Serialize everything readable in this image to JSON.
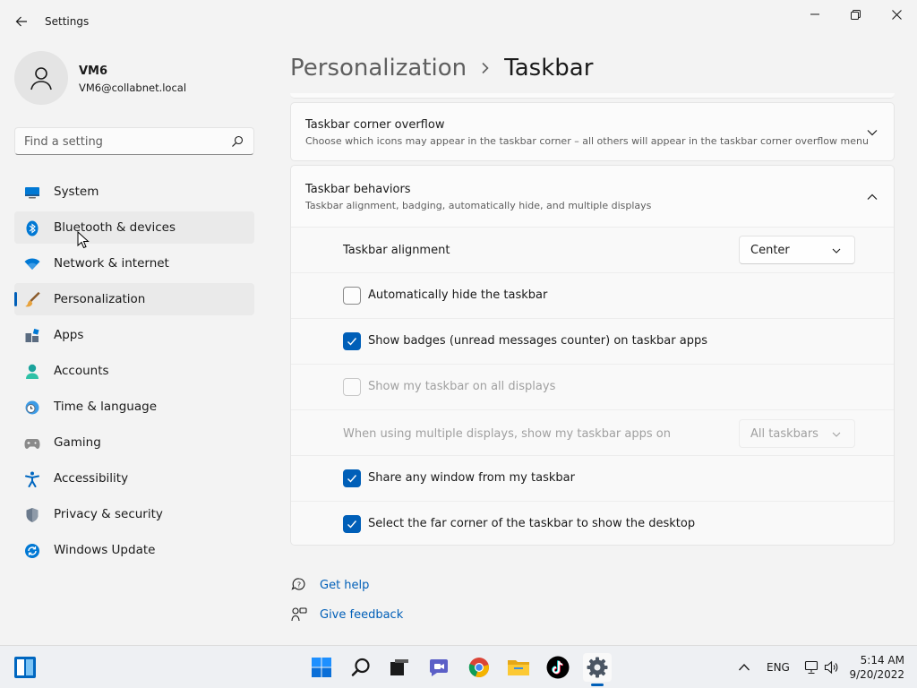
{
  "window": {
    "title": "Settings"
  },
  "profile": {
    "name": "VM6",
    "email": "VM6@collabnet.local"
  },
  "search": {
    "placeholder": "Find a setting"
  },
  "sidebar": {
    "items": [
      {
        "label": "System",
        "icon": "monitor-icon"
      },
      {
        "label": "Bluetooth & devices",
        "icon": "bluetooth-icon"
      },
      {
        "label": "Network & internet",
        "icon": "wifi-icon"
      },
      {
        "label": "Personalization",
        "icon": "paintbrush-icon"
      },
      {
        "label": "Apps",
        "icon": "apps-icon"
      },
      {
        "label": "Accounts",
        "icon": "person-icon"
      },
      {
        "label": "Time & language",
        "icon": "clock-globe-icon"
      },
      {
        "label": "Gaming",
        "icon": "gamepad-icon"
      },
      {
        "label": "Accessibility",
        "icon": "accessibility-icon"
      },
      {
        "label": "Privacy & security",
        "icon": "shield-icon"
      },
      {
        "label": "Windows Update",
        "icon": "update-icon"
      }
    ],
    "active": "Personalization",
    "hovered": "Bluetooth & devices"
  },
  "breadcrumb": {
    "parent": "Personalization",
    "current": "Taskbar"
  },
  "overflow_card": {
    "title": "Taskbar corner overflow",
    "description": "Choose which icons may appear in the taskbar corner – all others will appear in the taskbar corner overflow menu"
  },
  "behaviors_card": {
    "title": "Taskbar behaviors",
    "description": "Taskbar alignment, badging, automatically hide, and multiple displays",
    "alignment": {
      "label": "Taskbar alignment",
      "value": "Center"
    },
    "auto_hide": {
      "label": "Automatically hide the taskbar",
      "checked": false
    },
    "badges": {
      "label": "Show badges (unread messages counter) on taskbar apps",
      "checked": true
    },
    "all_displays": {
      "label": "Show my taskbar on all displays",
      "checked": false,
      "disabled": true
    },
    "multi_display": {
      "label": "When using multiple displays, show my taskbar apps on",
      "value": "All taskbars",
      "disabled": true
    },
    "share_window": {
      "label": "Share any window from my taskbar",
      "checked": true
    },
    "far_corner": {
      "label": "Select the far corner of the taskbar to show the desktop",
      "checked": true
    }
  },
  "help": {
    "get_help": "Get help",
    "give_feedback": "Give feedback"
  },
  "taskbar": {
    "apps": [
      "start-icon",
      "search-icon",
      "task-view-icon",
      "chat-icon",
      "chrome-icon",
      "file-explorer-icon",
      "tiktok-icon",
      "settings-icon"
    ],
    "language": "ENG",
    "time": "5:14 AM",
    "date": "9/20/2022"
  },
  "colors": {
    "accent": "#005fb8",
    "background": "#f3f3f3",
    "card": "#fbfbfb"
  }
}
